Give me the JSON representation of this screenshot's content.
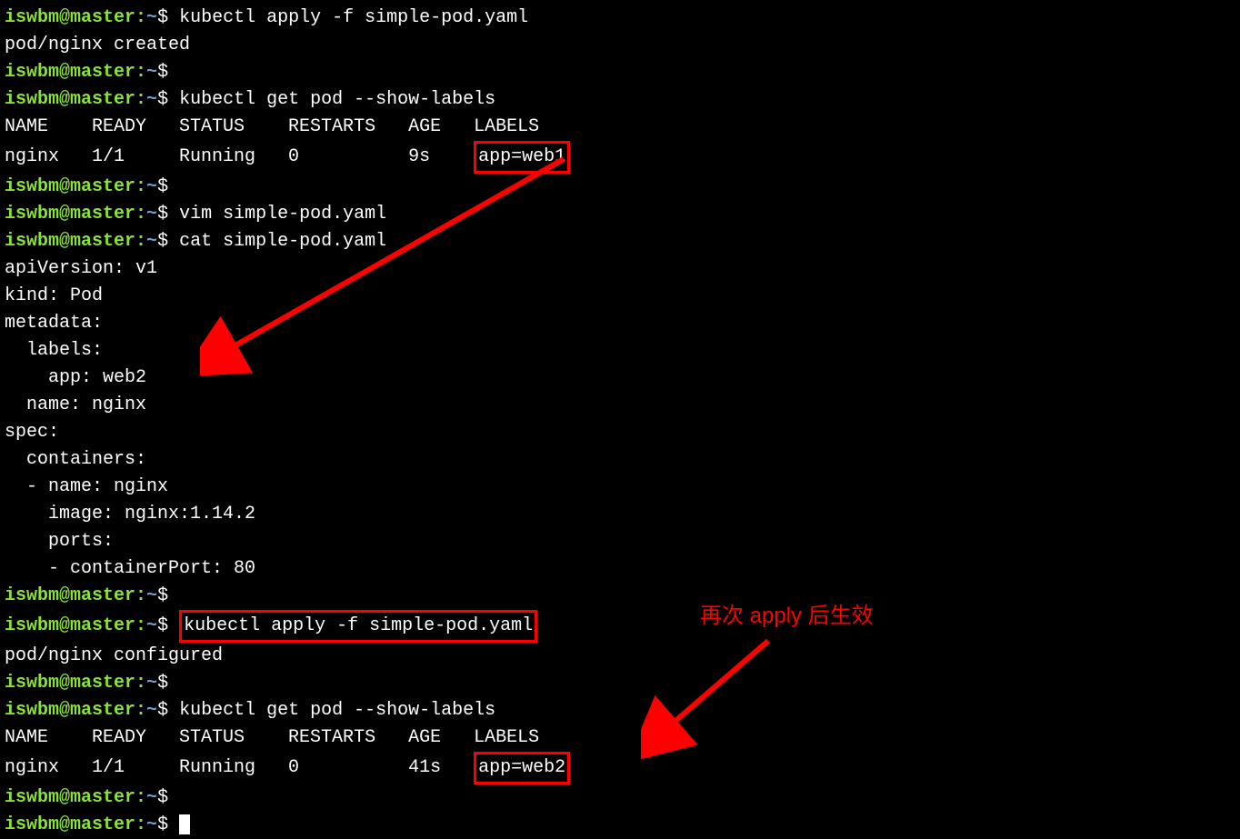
{
  "prompt": {
    "user_host": "iswbm@master",
    "sep": ":",
    "path": "~",
    "dollar": "$"
  },
  "lines": {
    "cmd1": "kubectl apply -f simple-pod.yaml",
    "out1": "pod/nginx created",
    "cmd2": "kubectl get pod --show-labels",
    "table1_header": "NAME    READY   STATUS    RESTARTS   AGE   LABELS",
    "table1_row_prefix": "nginx   1/1     Running   0          9s    ",
    "table1_label": "app=web1",
    "cmd3": "vim simple-pod.yaml",
    "cmd4": "cat simple-pod.yaml",
    "yaml1": "apiVersion: v1",
    "yaml2": "kind: Pod",
    "yaml3": "metadata:",
    "yaml4": "  labels:",
    "yaml5": "    app: web2",
    "yaml6": "  name: nginx",
    "yaml7": "spec:",
    "yaml8": "  containers:",
    "yaml9": "  - name: nginx",
    "yaml10": "    image: nginx:1.14.2",
    "yaml11": "    ports:",
    "yaml12": "    - containerPort: 80",
    "cmd5": "kubectl apply -f simple-pod.yaml",
    "out2": "pod/nginx configured",
    "cmd6": "kubectl get pod --show-labels",
    "table2_header": "NAME    READY   STATUS    RESTARTS   AGE   LABELS",
    "table2_row_prefix": "nginx   1/1     Running   0          41s   ",
    "table2_label": "app=web2"
  },
  "annotation": "再次 apply 后生效"
}
